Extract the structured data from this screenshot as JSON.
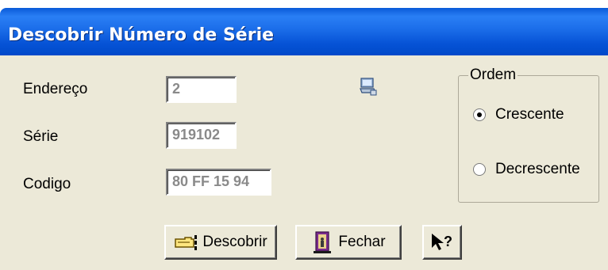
{
  "window": {
    "title": "Descobrir Número de Série"
  },
  "form": {
    "endereco": {
      "label": "Endereço",
      "value": "2"
    },
    "serie": {
      "label": "Série",
      "value": "919102"
    },
    "codigo": {
      "label": "Codigo",
      "value": "80 FF 15 94"
    }
  },
  "ordem": {
    "title": "Ordem",
    "options": [
      {
        "label": "Crescente",
        "selected": true
      },
      {
        "label": "Decrescente",
        "selected": false
      }
    ]
  },
  "buttons": {
    "descobrir": "Descobrir",
    "fechar": "Fechar"
  },
  "icons": {
    "descobrir": "pointing-hand-icon",
    "fechar": "door-exit-icon",
    "help": "help-pointer-icon",
    "device": "computer-icon"
  }
}
